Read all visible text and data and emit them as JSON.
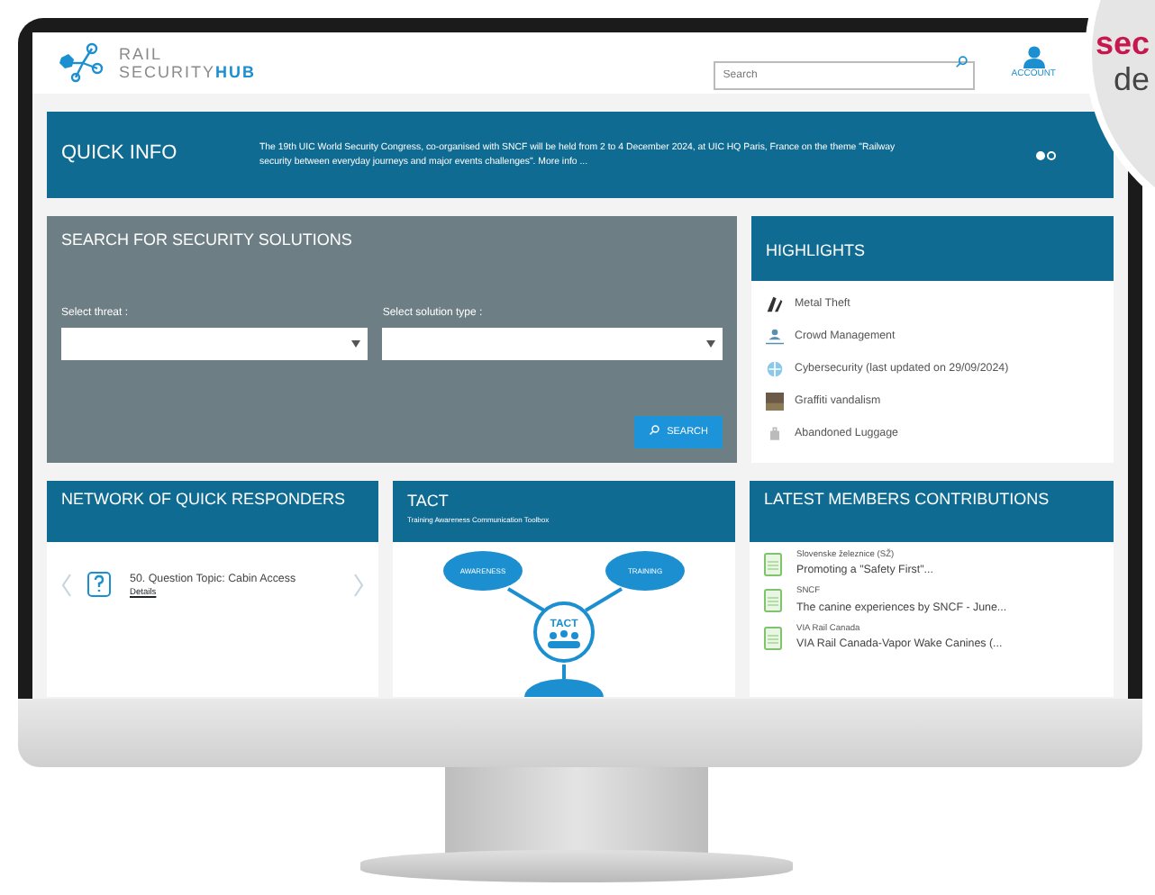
{
  "header": {
    "logo": {
      "line1": "RAIL",
      "line2_a": "SECURITY",
      "line2_b": "HUB"
    },
    "search": {
      "placeholder": "Search"
    },
    "account": "ACCOUNT"
  },
  "quick_info": {
    "title": "QUICK INFO",
    "text": "The 19th UIC World Security Congress, co-organised with SNCF will be held from 2 to 4 December 2024, at UIC HQ Paris, France on the theme \"Railway security between everyday journeys and major events challenges\". More info ...",
    "dots": [
      {
        "selected": true
      },
      {
        "selected": false
      }
    ]
  },
  "search_panel": {
    "title": "SEARCH FOR SECURITY SOLUTIONS",
    "fields": [
      {
        "label": "Select threat :"
      },
      {
        "label": "Select solution type :"
      }
    ],
    "button": "SEARCH"
  },
  "highlights": {
    "title": "HIGHLIGHTS",
    "items": [
      {
        "label": "Metal Theft",
        "kind": "tools"
      },
      {
        "label": "Crowd Management",
        "kind": "crowd"
      },
      {
        "label": "Cybersecurity (last updated on 29/09/2024)",
        "kind": "cyber"
      },
      {
        "label": "Graffiti vandalism",
        "kind": "photo"
      },
      {
        "label": "Abandoned Luggage",
        "kind": "luggage"
      }
    ]
  },
  "quick_responders": {
    "title": "NETWORK OF QUICK RESPONDERS",
    "item": "50. Question Topic: Cabin Access",
    "link": "Details"
  },
  "tact": {
    "title": "TACT",
    "subtitle": "Training Awareness Communication Toolbox",
    "center": "TACT",
    "nodes": [
      "AWARENESS",
      "TRAINING"
    ]
  },
  "contributions": {
    "title": "LATEST MEMBERS CONTRIBUTIONS",
    "items": [
      {
        "author": "Slovenske železnice (SŽ)",
        "title": "Promoting a \"Safety First\"..."
      },
      {
        "author": "SNCF",
        "title": "The canine experiences by SNCF - June..."
      },
      {
        "author": "VIA Rail Canada",
        "title": "VIA Rail Canada-Vapor Wake Canines (..."
      }
    ]
  },
  "overlay": {
    "line1": "sec",
    "line2": "de"
  }
}
